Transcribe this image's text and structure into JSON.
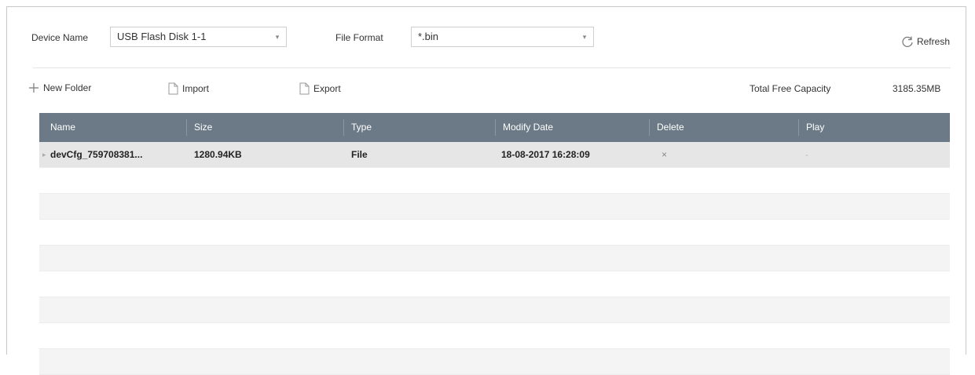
{
  "toolbar": {
    "device_name_label": "Device Name",
    "device_name_value": "USB Flash Disk 1-1",
    "file_format_label": "File Format",
    "file_format_value": "*.bin",
    "refresh_label": "Refresh"
  },
  "actions": {
    "new_folder": "New Folder",
    "import": "Import",
    "export": "Export",
    "total_free_capacity_label": "Total Free Capacity",
    "total_free_capacity_value": "3185.35MB"
  },
  "table": {
    "columns": [
      "Name",
      "Size",
      "Type",
      "Modify Date",
      "Delete",
      "Play"
    ],
    "rows": [
      {
        "name": "devCfg_759708381...",
        "size": "1280.94KB",
        "type": "File",
        "modify_date": "18-08-2017 16:28:09",
        "delete": "×",
        "play": "-"
      }
    ]
  },
  "icons": {
    "combo_arrow": "chevron-down-icon",
    "refresh": "refresh-icon",
    "new_folder": "plus-icon",
    "file": "file-icon",
    "folder_row": "file-row-icon"
  }
}
